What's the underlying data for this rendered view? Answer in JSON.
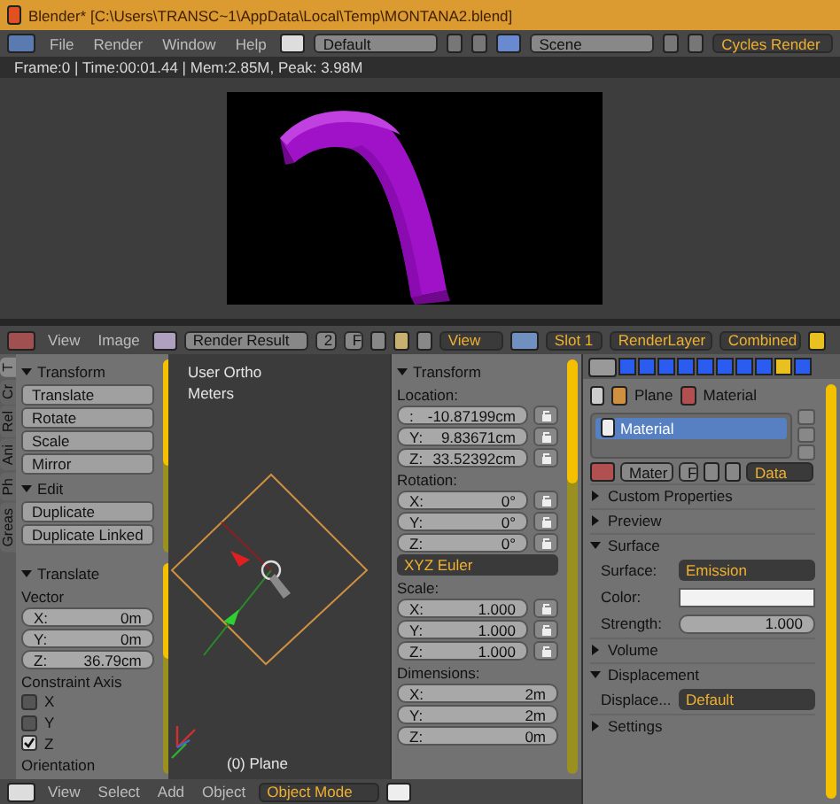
{
  "window": {
    "title": "Blender* [C:\\Users\\TRANSC~1\\AppData\\Local\\Temp\\MONTANA2.blend]"
  },
  "top_bar": {
    "menus": [
      "File",
      "Render",
      "Window",
      "Help"
    ],
    "screen_layout": "Default",
    "scene": "Scene",
    "render_engine": "Cycles Render"
  },
  "render_info": "Frame:0 | Time:00:01.44 | Mem:2.85M, Peak: 3.98M",
  "image_editor_header": {
    "menus": [
      "View",
      "Image"
    ],
    "image": "Render Result",
    "users": "2",
    "fake_user": "F",
    "view": "View",
    "slot": "Slot 1",
    "render_layer": "RenderLayer",
    "render_pass": "Combined"
  },
  "tool_shelf": {
    "tabs": [
      {
        "label": "T",
        "selected": true
      },
      {
        "label": "Cr",
        "selected": false
      },
      {
        "label": "Rel",
        "selected": false
      },
      {
        "label": "Ani",
        "selected": false
      },
      {
        "label": "Ph",
        "selected": false
      },
      {
        "label": "Greas",
        "selected": false
      }
    ],
    "panels": [
      {
        "title": "Transform",
        "expanded": true,
        "buttons": [
          "Translate",
          "Rotate",
          "Scale",
          "Mirror"
        ]
      },
      {
        "title": "Edit",
        "expanded": true,
        "buttons": [
          "Duplicate",
          "Duplicate Linked"
        ]
      }
    ]
  },
  "last_operator": {
    "title": "Translate",
    "expanded": true,
    "vector_label": "Vector",
    "vector": [
      {
        "label": "X:",
        "value": "0m"
      },
      {
        "label": "Y:",
        "value": "0m"
      },
      {
        "label": "Z:",
        "value": "36.79cm"
      }
    ],
    "constraint_label": "Constraint Axis",
    "constraints": [
      {
        "label": "X",
        "checked": false
      },
      {
        "label": "Y",
        "checked": false
      },
      {
        "label": "Z",
        "checked": true
      }
    ],
    "orientation_label": "Orientation"
  },
  "viewport": {
    "view_name": "User Ortho",
    "units": "Meters",
    "object_label": "(0) Plane"
  },
  "viewport_header": {
    "menus": [
      "View",
      "Select",
      "Add",
      "Object"
    ],
    "mode": "Object Mode"
  },
  "n_panel": {
    "title": "Transform",
    "expanded": true,
    "items": [
      {
        "kind": "heading",
        "text": "Location:"
      },
      {
        "kind": "field",
        "label": ":",
        "value": "-10.87199cm",
        "lock_button": true
      },
      {
        "kind": "field",
        "label": "Y:",
        "value": "9.83671cm",
        "lock_button": true
      },
      {
        "kind": "field",
        "label": "Z:",
        "value": "33.52392cm",
        "lock_button": true
      },
      {
        "kind": "heading",
        "text": "Rotation:"
      },
      {
        "kind": "field",
        "label": "X:",
        "value": "0°",
        "lock_button": true
      },
      {
        "kind": "field",
        "label": "Y:",
        "value": "0°",
        "lock_button": true
      },
      {
        "kind": "field",
        "label": "Z:",
        "value": "0°",
        "lock_button": true
      },
      {
        "kind": "dropdown",
        "value": "XYZ Euler"
      },
      {
        "kind": "heading",
        "text": "Scale:"
      },
      {
        "kind": "field",
        "label": "X:",
        "value": "1.000",
        "lock_button": true
      },
      {
        "kind": "field",
        "label": "Y:",
        "value": "1.000",
        "lock_button": true
      },
      {
        "kind": "field",
        "label": "Z:",
        "value": "1.000",
        "lock_button": true
      },
      {
        "kind": "heading",
        "text": "Dimensions:"
      },
      {
        "kind": "field",
        "label": "X:",
        "value": "2m",
        "lock_button": false
      },
      {
        "kind": "field",
        "label": "Y:",
        "value": "2m",
        "lock_button": false
      },
      {
        "kind": "field",
        "label": "Z:",
        "value": "0m",
        "lock_button": false
      }
    ]
  },
  "properties": {
    "tabs": [
      {
        "selected": false
      },
      {
        "selected": false
      },
      {
        "selected": false
      },
      {
        "selected": false
      },
      {
        "selected": false
      },
      {
        "selected": false
      },
      {
        "selected": false
      },
      {
        "selected": false
      },
      {
        "selected": true
      },
      {
        "selected": false
      }
    ],
    "breadcrumb": [
      "Plane",
      "Material"
    ],
    "material_slots": [
      {
        "name": "Material",
        "selected": true
      }
    ],
    "datablock": {
      "name": "Mater",
      "fake_user": "F",
      "link": "Data"
    },
    "panels": [
      {
        "title": "Custom Properties",
        "expanded": false
      },
      {
        "title": "Preview",
        "expanded": false
      },
      {
        "title": "Surface",
        "expanded": true,
        "rows": [
          {
            "kind": "dropdown",
            "label": "Surface:",
            "value": "Emission"
          },
          {
            "kind": "color",
            "label": "Color:",
            "color": "#f2f2f2"
          },
          {
            "kind": "number",
            "label": "Strength:",
            "value": "1.000"
          }
        ]
      },
      {
        "title": "Volume",
        "expanded": false
      },
      {
        "title": "Displacement",
        "expanded": true,
        "rows": [
          {
            "kind": "dropdown",
            "label": "Displace...",
            "value": "Default"
          }
        ]
      },
      {
        "title": "Settings",
        "expanded": false
      }
    ]
  }
}
